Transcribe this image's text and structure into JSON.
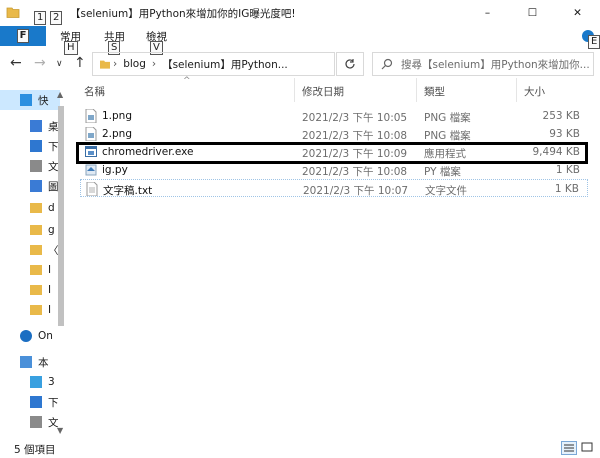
{
  "window": {
    "title": "【selenium】用Python來增加你的IG曝光度吧!",
    "minimize_glyph": "–",
    "maximize_glyph": "☐",
    "close_glyph": "✕"
  },
  "quick_access_toolbar": {
    "keytips": [
      "1",
      "2"
    ]
  },
  "ribbon": {
    "file_keytip": "F",
    "tabs": [
      {
        "label": "常用",
        "keytip": "H"
      },
      {
        "label": "共用",
        "keytip": "S"
      },
      {
        "label": "檢視",
        "keytip": "V"
      }
    ],
    "help_keytip": "E"
  },
  "address": {
    "crumbs": [
      "blog",
      "【selenium】用Python..."
    ],
    "separator": "›"
  },
  "search": {
    "placeholder": "搜尋【selenium】用Python來增加你..."
  },
  "nav_pane": {
    "items": [
      {
        "label": "快",
        "icon": "star-icon",
        "selected": true
      },
      {
        "label": "桌",
        "icon": "desktop-icon"
      },
      {
        "label": "下",
        "icon": "download-icon"
      },
      {
        "label": "文",
        "icon": "document-icon"
      },
      {
        "label": "圖",
        "icon": "picture-icon"
      },
      {
        "label": "d",
        "icon": "folder-icon"
      },
      {
        "label": "g",
        "icon": "folder-icon"
      },
      {
        "label": "〈",
        "icon": "folder-icon"
      },
      {
        "label": "I",
        "icon": "folder-icon"
      },
      {
        "label": "I",
        "icon": "folder-icon"
      },
      {
        "label": "I",
        "icon": "folder-icon"
      },
      {
        "label": "On",
        "icon": "cloud-icon"
      },
      {
        "label": "本",
        "icon": "computer-icon"
      },
      {
        "label": "3",
        "icon": "cube-icon"
      },
      {
        "label": "下",
        "icon": "download-icon"
      },
      {
        "label": "文",
        "icon": "document-icon"
      }
    ]
  },
  "columns": {
    "name": "名稱",
    "date": "修改日期",
    "type": "類型",
    "size": "大小",
    "sort_glyph": "^"
  },
  "files": [
    {
      "name": "1.png",
      "date": "2021/2/3 下午 10:05",
      "type": "PNG 檔案",
      "size": "253 KB",
      "icon": "image-file-icon"
    },
    {
      "name": "2.png",
      "date": "2021/2/3 下午 10:08",
      "type": "PNG 檔案",
      "size": "93 KB",
      "icon": "image-file-icon"
    },
    {
      "name": "chromedriver.exe",
      "date": "2021/2/3 下午 10:09",
      "type": "應用程式",
      "size": "9,494 KB",
      "icon": "application-icon"
    },
    {
      "name": "ig.py",
      "date": "2021/2/3 下午 10:08",
      "type": "PY 檔案",
      "size": "1 KB",
      "icon": "python-file-icon"
    },
    {
      "name": "文字稿.txt",
      "date": "2021/2/3 下午 10:07",
      "type": "文字文件",
      "size": "1 KB",
      "icon": "text-file-icon"
    }
  ],
  "status": {
    "item_count": "5 個項目"
  },
  "colors": {
    "accent": "#1979ca",
    "selection": "#cce8ff",
    "highlight_border": "#000000"
  }
}
